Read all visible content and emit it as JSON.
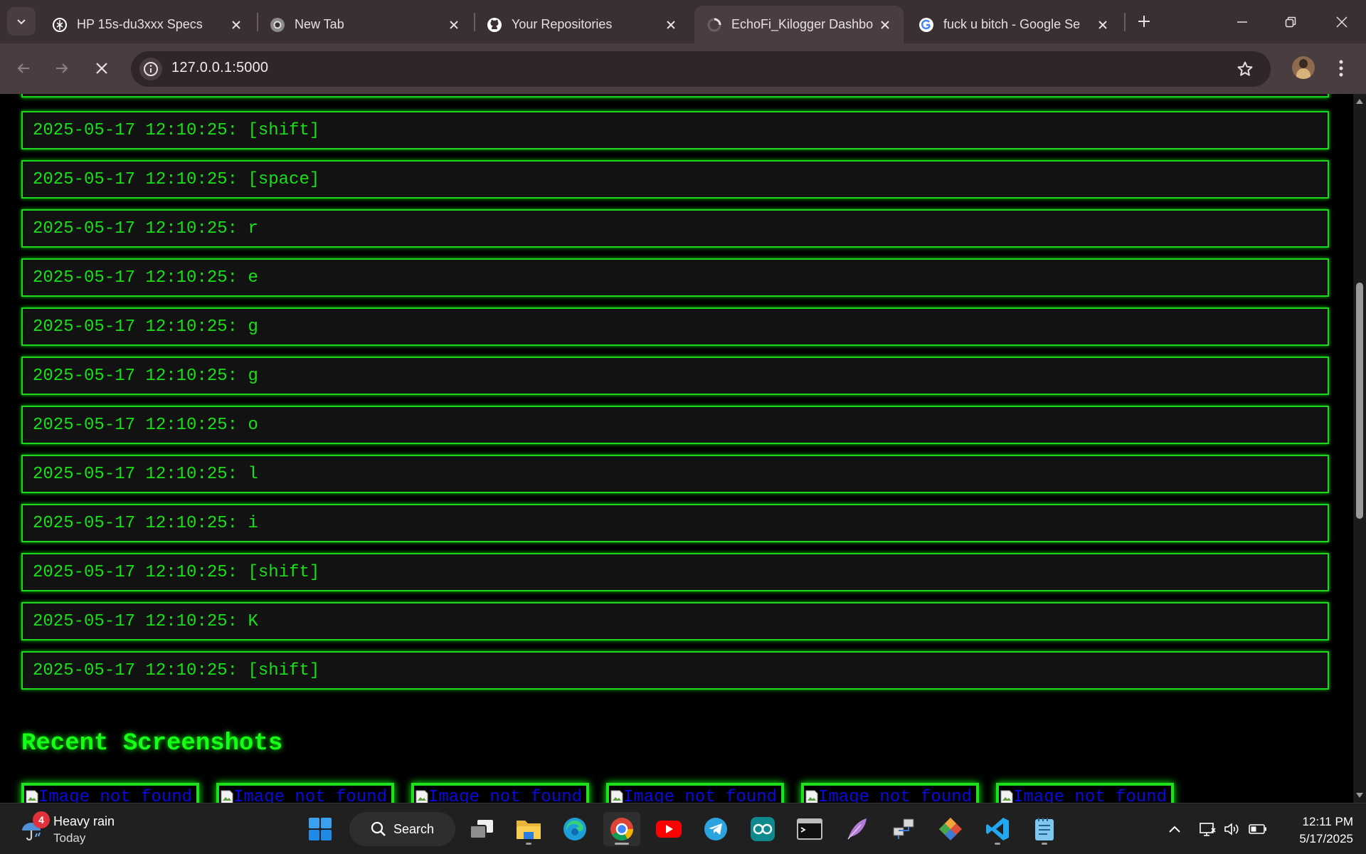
{
  "browser": {
    "tabs": [
      {
        "title": "HP 15s-du3xxx Specs",
        "icon": "chatgpt-icon",
        "active": false
      },
      {
        "title": "New Tab",
        "icon": "chrome-icon",
        "active": false
      },
      {
        "title": "Your Repositories",
        "icon": "github-icon",
        "active": false
      },
      {
        "title": "EchoFi_Kilogger Dashbo",
        "icon": "loading-icon",
        "active": true
      },
      {
        "title": "fuck u bitch - Google Se",
        "icon": "google-icon",
        "active": false
      }
    ],
    "address_bar": {
      "url": "127.0.0.1:5000"
    }
  },
  "page": {
    "log_entries": [
      "2025-05-17 12:10:25: [shift]",
      "2025-05-17 12:10:25: [space]",
      "2025-05-17 12:10:25: r",
      "2025-05-17 12:10:25: e",
      "2025-05-17 12:10:25: g",
      "2025-05-17 12:10:25: g",
      "2025-05-17 12:10:25: o",
      "2025-05-17 12:10:25: l",
      "2025-05-17 12:10:25: i",
      "2025-05-17 12:10:25: [shift]",
      "2025-05-17 12:10:25: K",
      "2025-05-17 12:10:25: [shift]"
    ],
    "screenshots_title": "Recent Screenshots",
    "screenshots": [
      {
        "alt": "Image not found"
      },
      {
        "alt": "Image not found"
      },
      {
        "alt": "Image not found"
      },
      {
        "alt": "Image not found"
      },
      {
        "alt": "Image not found"
      },
      {
        "alt": "Image not found"
      }
    ],
    "colors": {
      "log_text": "#19e019",
      "log_border": "#1ed61e",
      "heading": "#16ff16",
      "alt_text": "#0a0add"
    }
  },
  "taskbar": {
    "weather": {
      "title": "Heavy rain",
      "subtitle": "Today",
      "badge": "4",
      "icon": "umbrella-rain-icon"
    },
    "search_label": "Search",
    "apps": [
      "windows-start-icon",
      "task-view-icon",
      "file-explorer-icon",
      "edge-icon",
      "chrome-icon",
      "youtube-icon",
      "telegram-icon",
      "arduino-icon",
      "terminal-icon",
      "feather-app-icon",
      "network-app-icon",
      "git-tool-icon",
      "vscode-icon",
      "notepad-icon"
    ],
    "clock": {
      "time": "12:11 PM",
      "date": "5/17/2025"
    }
  }
}
